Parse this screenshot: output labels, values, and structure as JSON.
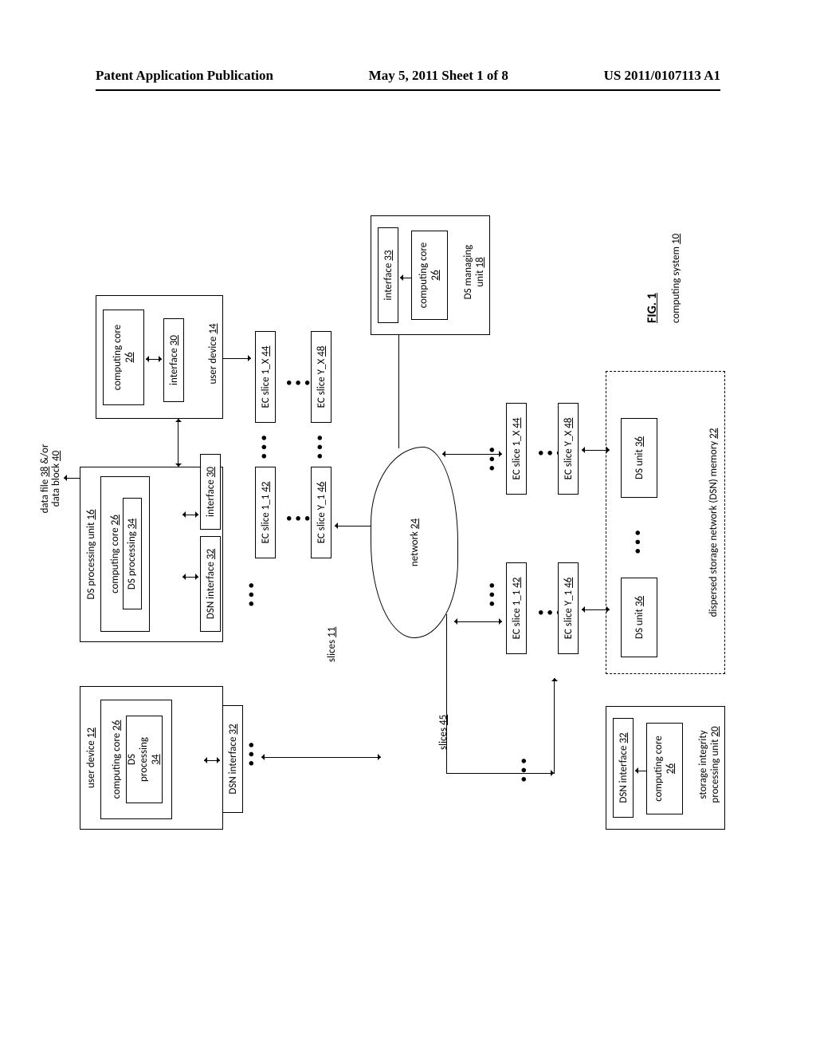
{
  "header": {
    "left": "Patent Application Publication",
    "center": "May 5, 2011  Sheet 1 of 8",
    "right": "US 2011/0107113 A1"
  },
  "figure": {
    "title_label": "FIG. 1",
    "system_label": "computing system",
    "system_ref": "10"
  },
  "blocks": {
    "user_device_12": "user device",
    "ref_12": "12",
    "computing_core": "computing core",
    "ref_26": "26",
    "ds_processing": "DS\nprocessing",
    "ref_34": "34",
    "dsn_interface": "DSN interface",
    "ref_32": "32",
    "ds_proc_unit": "DS processing unit",
    "ref_16": "16",
    "interface": "interface",
    "ref_30": "30",
    "data_file": "data file",
    "ref_38": "38",
    "data_block": "data block",
    "ref_40": "40",
    "amp_or": "&/or",
    "user_device_14": "user device",
    "ref_14": "14",
    "ec_slice_1_1": "EC slice 1_1",
    "ref_42": "42",
    "ec_slice_1_x": "EC slice 1_X",
    "ref_44": "44",
    "ec_slice_y_1": "EC slice Y_1",
    "ref_46": "46",
    "ec_slice_y_x": "EC slice Y_X",
    "ref_48": "48",
    "slices_11": "slices",
    "ref_11": "11",
    "slices_45": "slices",
    "ref_45": "45",
    "network": "network",
    "ref_24": "24",
    "storage_integrity": "storage integrity\nprocessing unit",
    "ref_20": "20",
    "ds_unit": "DS unit",
    "ref_36": "36",
    "dsn_memory": "dispersed storage network (DSN) memory",
    "ref_22": "22",
    "ds_managing": "DS managing\nunit",
    "ref_18": "18",
    "ref_33": "33"
  }
}
